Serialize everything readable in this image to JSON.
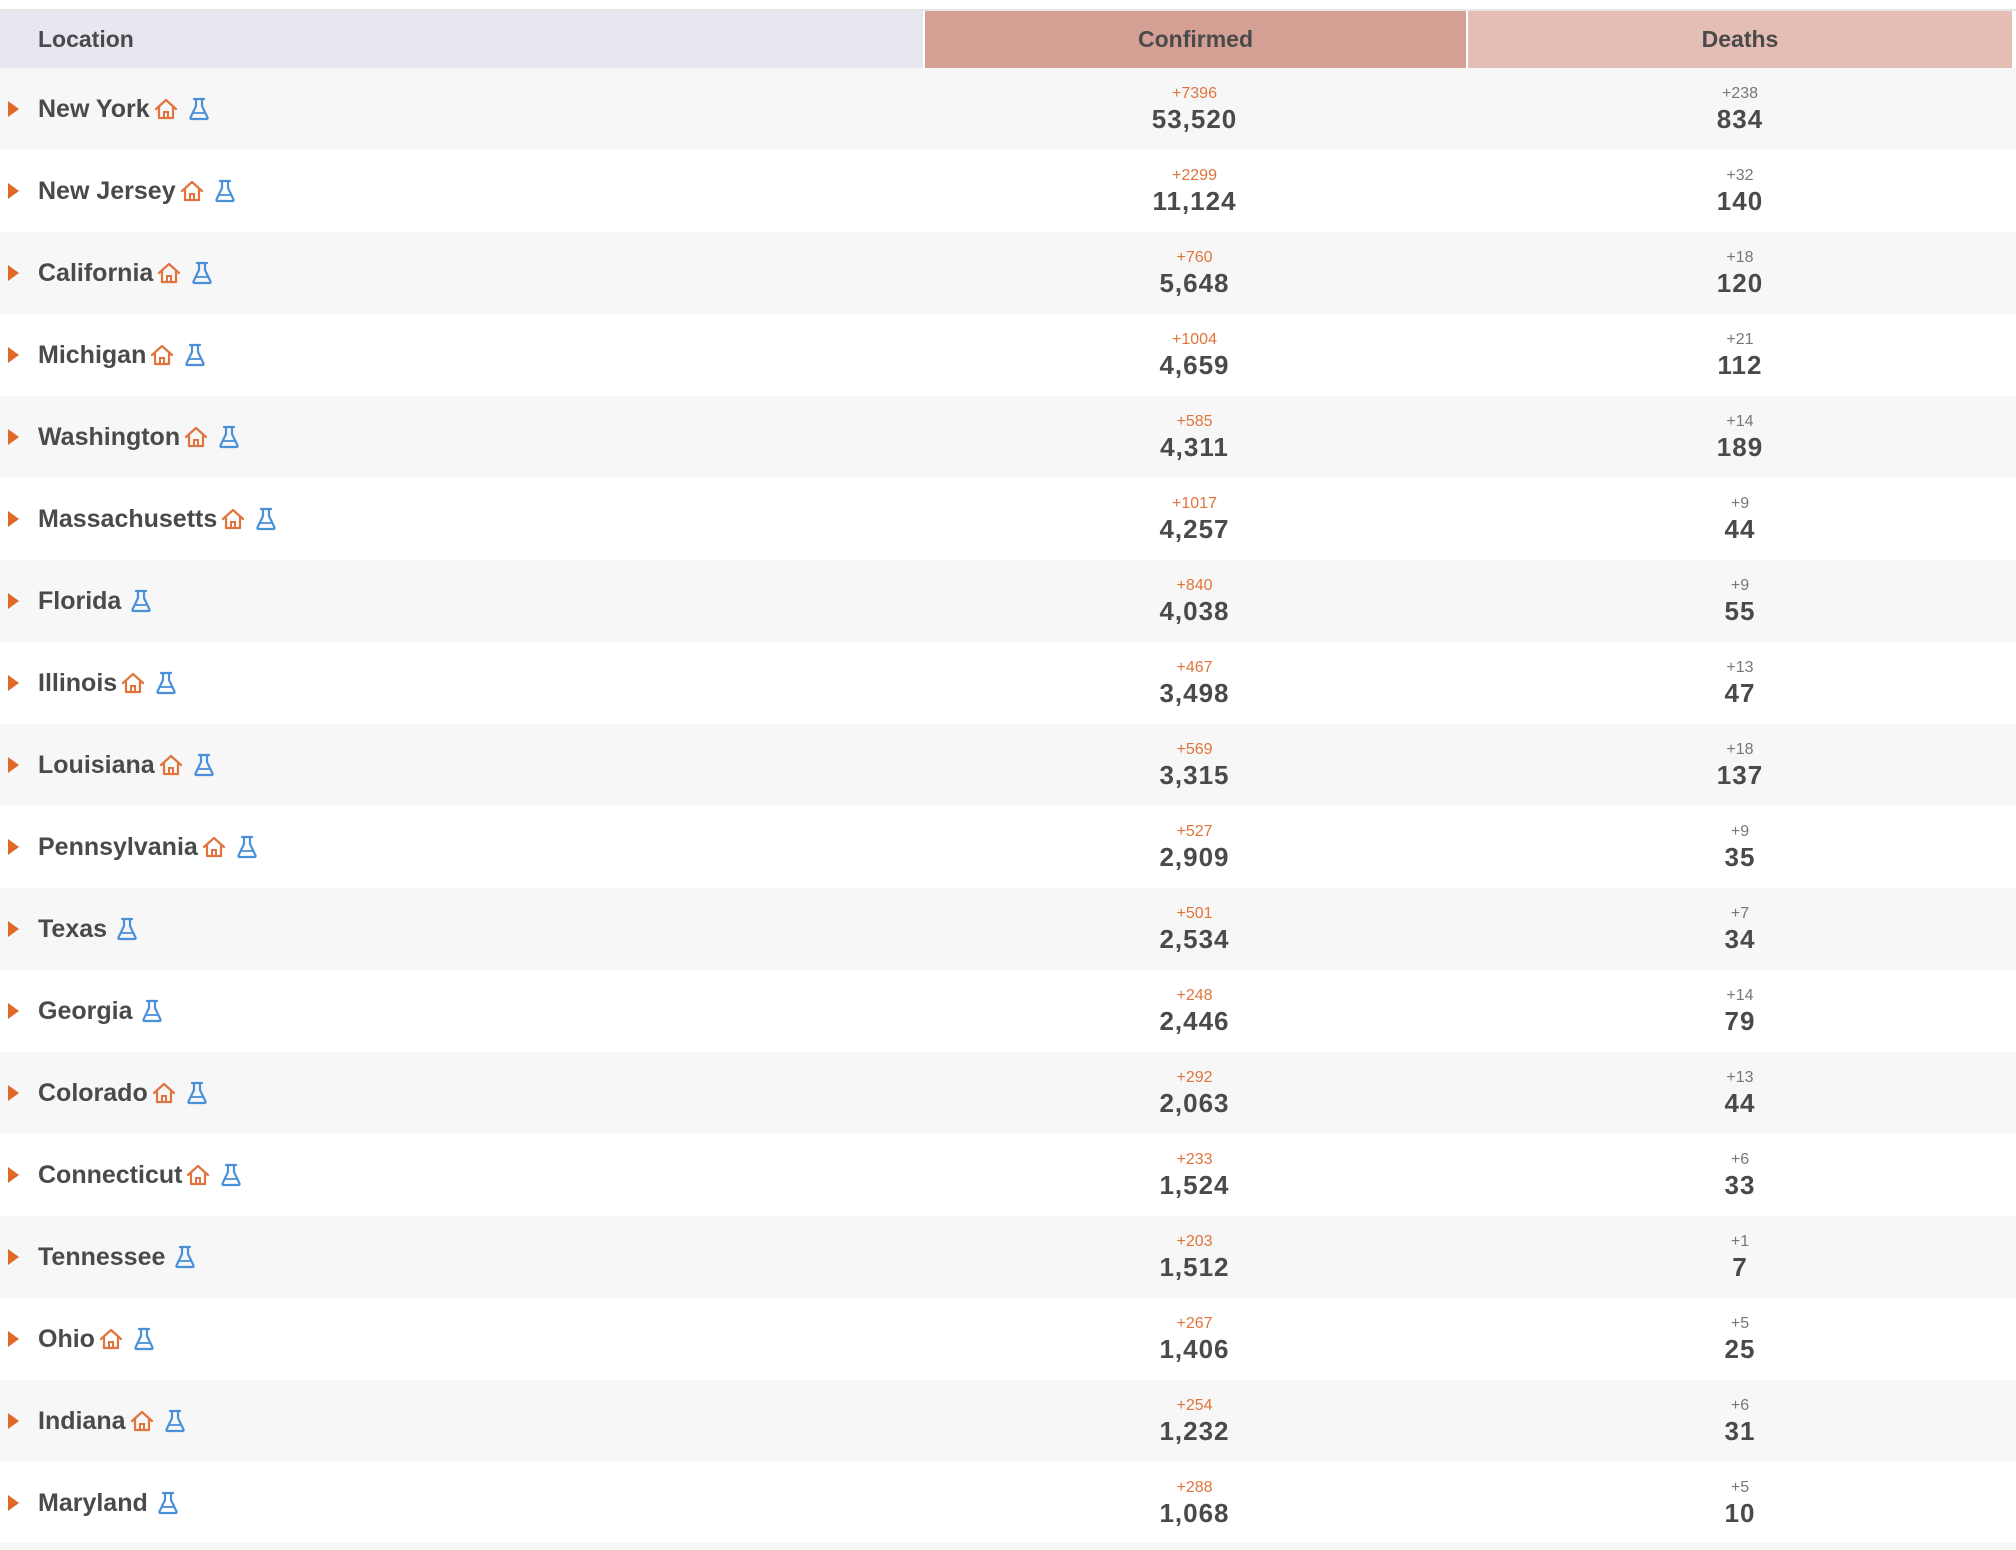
{
  "header": {
    "location": "Location",
    "confirmed": "Confirmed",
    "deaths": "Deaths"
  },
  "colors": {
    "location_header_bg": "#e6e7f1",
    "confirmed_header_bg": "#d4a094",
    "deaths_header_bg": "#e4bdb4",
    "expander": "#e0692a",
    "home_icon": "#e0743c",
    "flask_icon": "#4a90d9",
    "confirmed_delta": "#e0743c"
  },
  "rows": [
    {
      "name": "New York",
      "home": true,
      "flask": true,
      "confirmed_delta": "+7396",
      "confirmed": "53,520",
      "deaths_delta": "+238",
      "deaths": "834"
    },
    {
      "name": "New Jersey",
      "home": true,
      "flask": true,
      "confirmed_delta": "+2299",
      "confirmed": "11,124",
      "deaths_delta": "+32",
      "deaths": "140"
    },
    {
      "name": "California",
      "home": true,
      "flask": true,
      "confirmed_delta": "+760",
      "confirmed": "5,648",
      "deaths_delta": "+18",
      "deaths": "120"
    },
    {
      "name": "Michigan",
      "home": true,
      "flask": true,
      "confirmed_delta": "+1004",
      "confirmed": "4,659",
      "deaths_delta": "+21",
      "deaths": "112"
    },
    {
      "name": "Washington",
      "home": true,
      "flask": true,
      "confirmed_delta": "+585",
      "confirmed": "4,311",
      "deaths_delta": "+14",
      "deaths": "189"
    },
    {
      "name": "Massachusetts",
      "home": true,
      "flask": true,
      "confirmed_delta": "+1017",
      "confirmed": "4,257",
      "deaths_delta": "+9",
      "deaths": "44"
    },
    {
      "name": "Florida",
      "home": false,
      "flask": true,
      "confirmed_delta": "+840",
      "confirmed": "4,038",
      "deaths_delta": "+9",
      "deaths": "55"
    },
    {
      "name": "Illinois",
      "home": true,
      "flask": true,
      "confirmed_delta": "+467",
      "confirmed": "3,498",
      "deaths_delta": "+13",
      "deaths": "47"
    },
    {
      "name": "Louisiana",
      "home": true,
      "flask": true,
      "confirmed_delta": "+569",
      "confirmed": "3,315",
      "deaths_delta": "+18",
      "deaths": "137"
    },
    {
      "name": "Pennsylvania",
      "home": true,
      "flask": true,
      "confirmed_delta": "+527",
      "confirmed": "2,909",
      "deaths_delta": "+9",
      "deaths": "35"
    },
    {
      "name": "Texas",
      "home": false,
      "flask": true,
      "confirmed_delta": "+501",
      "confirmed": "2,534",
      "deaths_delta": "+7",
      "deaths": "34"
    },
    {
      "name": "Georgia",
      "home": false,
      "flask": true,
      "confirmed_delta": "+248",
      "confirmed": "2,446",
      "deaths_delta": "+14",
      "deaths": "79"
    },
    {
      "name": "Colorado",
      "home": true,
      "flask": true,
      "confirmed_delta": "+292",
      "confirmed": "2,063",
      "deaths_delta": "+13",
      "deaths": "44"
    },
    {
      "name": "Connecticut",
      "home": true,
      "flask": true,
      "confirmed_delta": "+233",
      "confirmed": "1,524",
      "deaths_delta": "+6",
      "deaths": "33"
    },
    {
      "name": "Tennessee",
      "home": false,
      "flask": true,
      "confirmed_delta": "+203",
      "confirmed": "1,512",
      "deaths_delta": "+1",
      "deaths": "7"
    },
    {
      "name": "Ohio",
      "home": true,
      "flask": true,
      "confirmed_delta": "+267",
      "confirmed": "1,406",
      "deaths_delta": "+5",
      "deaths": "25"
    },
    {
      "name": "Indiana",
      "home": true,
      "flask": true,
      "confirmed_delta": "+254",
      "confirmed": "1,232",
      "deaths_delta": "+6",
      "deaths": "31"
    },
    {
      "name": "Maryland",
      "home": false,
      "flask": true,
      "confirmed_delta": "+288",
      "confirmed": "1,068",
      "deaths_delta": "+5",
      "deaths": "10"
    }
  ]
}
